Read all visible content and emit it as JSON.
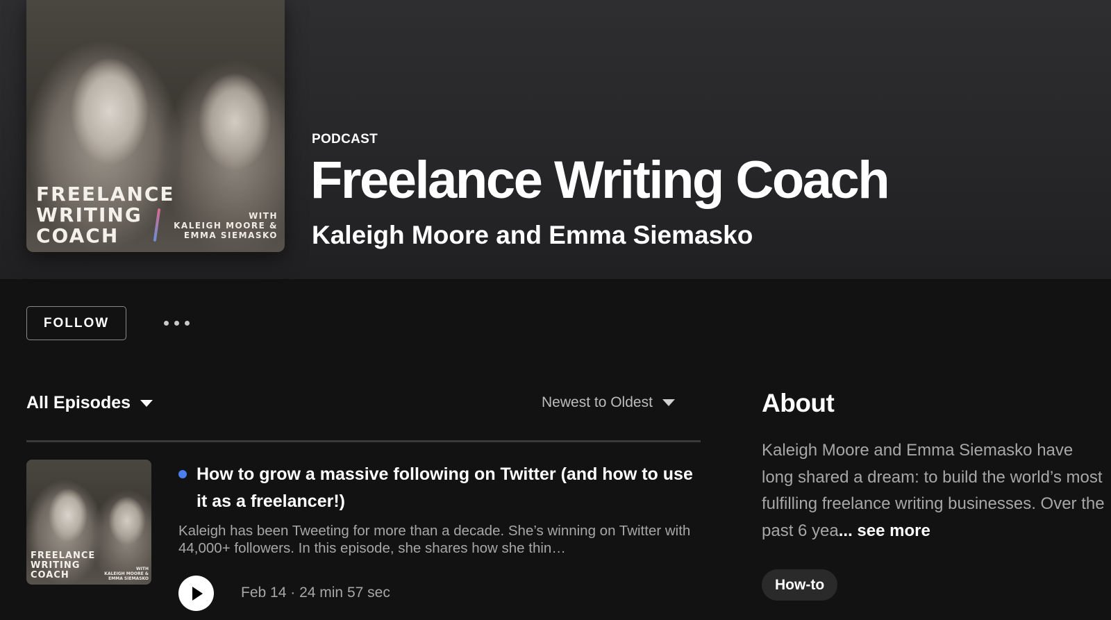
{
  "podcast": {
    "type_label": "PODCAST",
    "title": "Freelance Writing Coach",
    "author": "Kaleigh Moore and Emma Siemasko",
    "cover": {
      "title_lines": [
        "FREELANCE",
        "WRITING",
        "COACH"
      ],
      "with_lines": [
        "WITH",
        "KALEIGH MOORE &",
        "EMMA SIEMASKO"
      ]
    }
  },
  "actions": {
    "follow_label": "FOLLOW",
    "more_icon": "more-horizontal-icon"
  },
  "episodes_header": {
    "filter_label": "All Episodes",
    "sort_label": "Newest to Oldest"
  },
  "episode": {
    "title": "How to grow a massive following on Twitter (and how to use it as a freelancer!)",
    "description": "Kaleigh has been Tweeting for more than a decade. She’s winning on Twitter with 44,000+ followers. In this episode, she shares how she thin…",
    "date": "Feb 14",
    "separator": "·",
    "duration": "24 min 57 sec",
    "unplayed_dot_color": "#4b7ff0",
    "thumb": {
      "title_lines": [
        "FREELANCE",
        "WRITING",
        "COACH"
      ],
      "with_lines": [
        "WITH",
        "KALEIGH MOORE &",
        "EMMA SIEMASKO"
      ]
    }
  },
  "about": {
    "heading": "About",
    "text": "Kaleigh Moore and Emma Siemasko have long shared a dream: to build the world’s most fulfilling freelance writing businesses. Over the past 6 yea",
    "see_more": "... see more",
    "tag": "How-to"
  },
  "colors": {
    "background": "#121212",
    "hero_gradient_top": "#2e2e30",
    "muted_text": "#a7a7a7",
    "tag_bg": "#2a2a2a"
  }
}
